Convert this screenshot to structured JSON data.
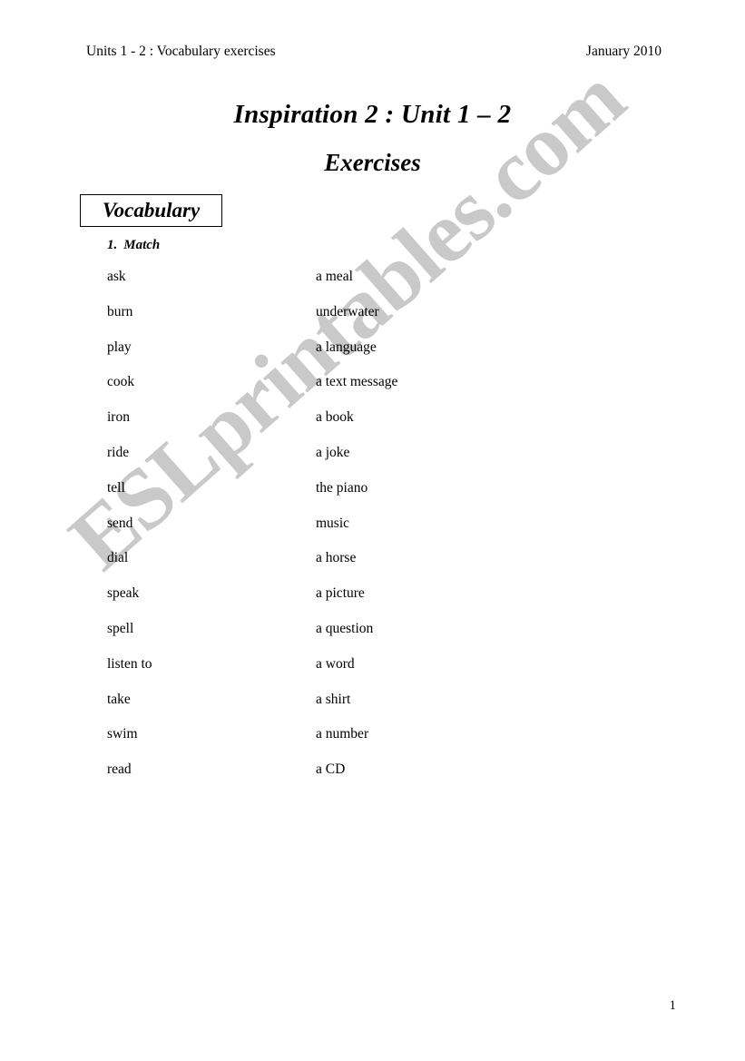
{
  "document": {
    "header": {
      "left_text": "Units 1 - 2 : Vocabulary exercises",
      "right_text": "January 2010"
    },
    "title": {
      "main": "Inspiration 2 : Unit 1 – 2",
      "sub": "Exercises"
    },
    "section": {
      "label": "Vocabulary"
    },
    "exercise": {
      "number": "1.",
      "title": "Match"
    },
    "match_pairs": [
      {
        "left": "ask",
        "right": "a meal"
      },
      {
        "left": "burn",
        "right": "underwater"
      },
      {
        "left": "play",
        "right": "a language"
      },
      {
        "left": "cook",
        "right": "a text message"
      },
      {
        "left": "iron",
        "right": "a book"
      },
      {
        "left": "ride",
        "right": "a joke"
      },
      {
        "left": "tell",
        "right": "the piano"
      },
      {
        "left": "send",
        "right": "music"
      },
      {
        "left": "dial",
        "right": "a horse"
      },
      {
        "left": "speak",
        "right": "a picture"
      },
      {
        "left": "spell",
        "right": "a question"
      },
      {
        "left": "listen to",
        "right": "a word"
      },
      {
        "left": "take",
        "right": "a shirt"
      },
      {
        "left": "swim",
        "right": "a number"
      },
      {
        "left": "read",
        "right": "a CD"
      }
    ],
    "watermark": {
      "text": "ESLprintables.com",
      "color": "#c9c9c9"
    },
    "footer": {
      "page_number": "1"
    },
    "colors": {
      "text": "#000000",
      "background": "#ffffff",
      "border": "#000000"
    }
  }
}
